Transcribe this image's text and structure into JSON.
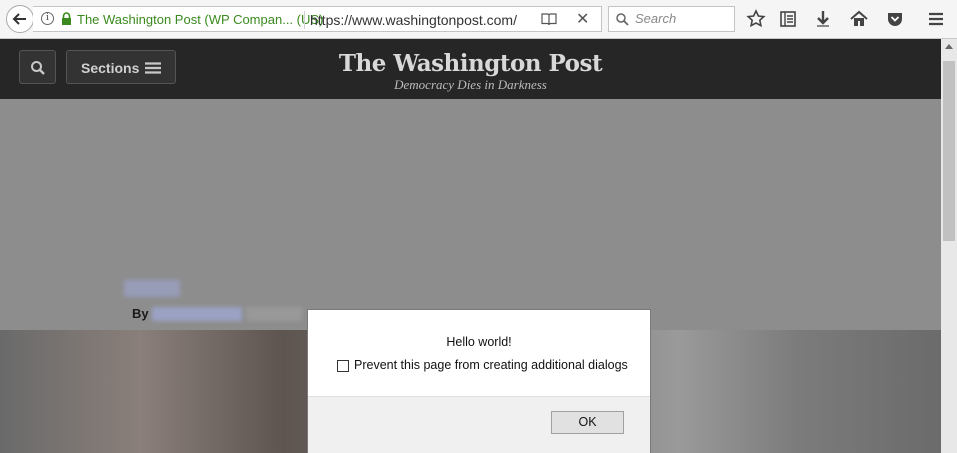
{
  "browser": {
    "site_identity": "The Washington Post (WP Compan... (US)",
    "url": "https://www.washingtonpost.com/",
    "search_placeholder": "Search",
    "identity_color": "#3a8a1e"
  },
  "header": {
    "sections_label": "Sections",
    "brand_name": "The Washington Post",
    "tagline": "Democracy Dies in Darkness",
    "background_color": "#262626"
  },
  "article": {
    "byline_prefix": "By"
  },
  "dialog": {
    "message": "Hello world!",
    "checkbox_label": "Prevent this page from creating additional dialogs",
    "checkbox_checked": false,
    "ok_label": "OK"
  },
  "icons": [
    "back-arrow-icon",
    "info-icon",
    "lock-icon",
    "reader-view-icon",
    "close-icon",
    "search-icon",
    "star-icon",
    "reading-list-icon",
    "download-icon",
    "home-icon",
    "pocket-icon",
    "menu-icon",
    "chevron-up-icon"
  ]
}
